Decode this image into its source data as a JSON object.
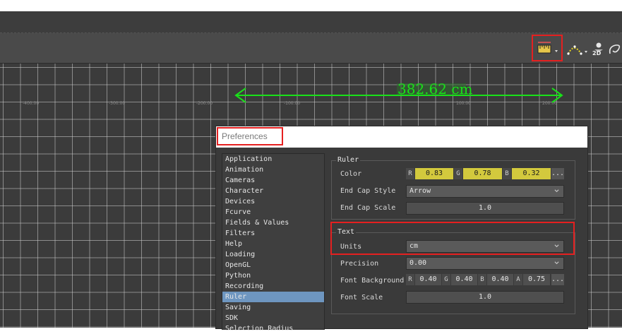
{
  "ruler": {
    "measurement": "382.62 cm",
    "ticks": [
      "-400.00",
      "-300.00",
      "-200.00",
      "-100.00",
      "100.00",
      "200.00"
    ]
  },
  "toolbar": {
    "icons": [
      "ruler-tool-icon",
      "curve-tool-icon",
      "view-2d-icon",
      "lasso-icon"
    ],
    "label_2d": "2D"
  },
  "preferences": {
    "title": "Preferences",
    "categories": [
      "Application",
      "Animation",
      "Cameras",
      "Character",
      "Devices",
      "Fcurve",
      "Fields & Values",
      "Filters",
      "Help",
      "Loading",
      "OpenGL",
      "Python",
      "Recording",
      "Ruler",
      "Saving",
      "SDK",
      "Selection Radius"
    ],
    "selected_category": "Ruler",
    "ruler_group": {
      "title": "Ruler",
      "color_label": "Color",
      "color_r_letter": "R",
      "color_r": "0.83",
      "color_g_letter": "G",
      "color_g": "0.78",
      "color_b_letter": "B",
      "color_b": "0.32",
      "color_more": "...",
      "end_cap_style_label": "End Cap Style",
      "end_cap_style": "Arrow",
      "end_cap_scale_label": "End Cap Scale",
      "end_cap_scale": "1.0"
    },
    "text_group": {
      "title": "Text",
      "units_label": "Units",
      "units": "cm",
      "precision_label": "Precision",
      "precision": "0.00",
      "font_background_label": "Font Background",
      "bg_r_letter": "R",
      "bg_r": "0.40",
      "bg_g_letter": "G",
      "bg_g": "0.40",
      "bg_b_letter": "B",
      "bg_b": "0.40",
      "bg_a_letter": "A",
      "bg_a": "0.75",
      "bg_more": "...",
      "font_scale_label": "Font Scale",
      "font_scale": "1.0"
    }
  },
  "colors": {
    "accent_highlight": "#e52020",
    "ruler_green": "#19e119",
    "field_yellow": "#d3c93d",
    "selection_blue": "#6e96c0"
  }
}
